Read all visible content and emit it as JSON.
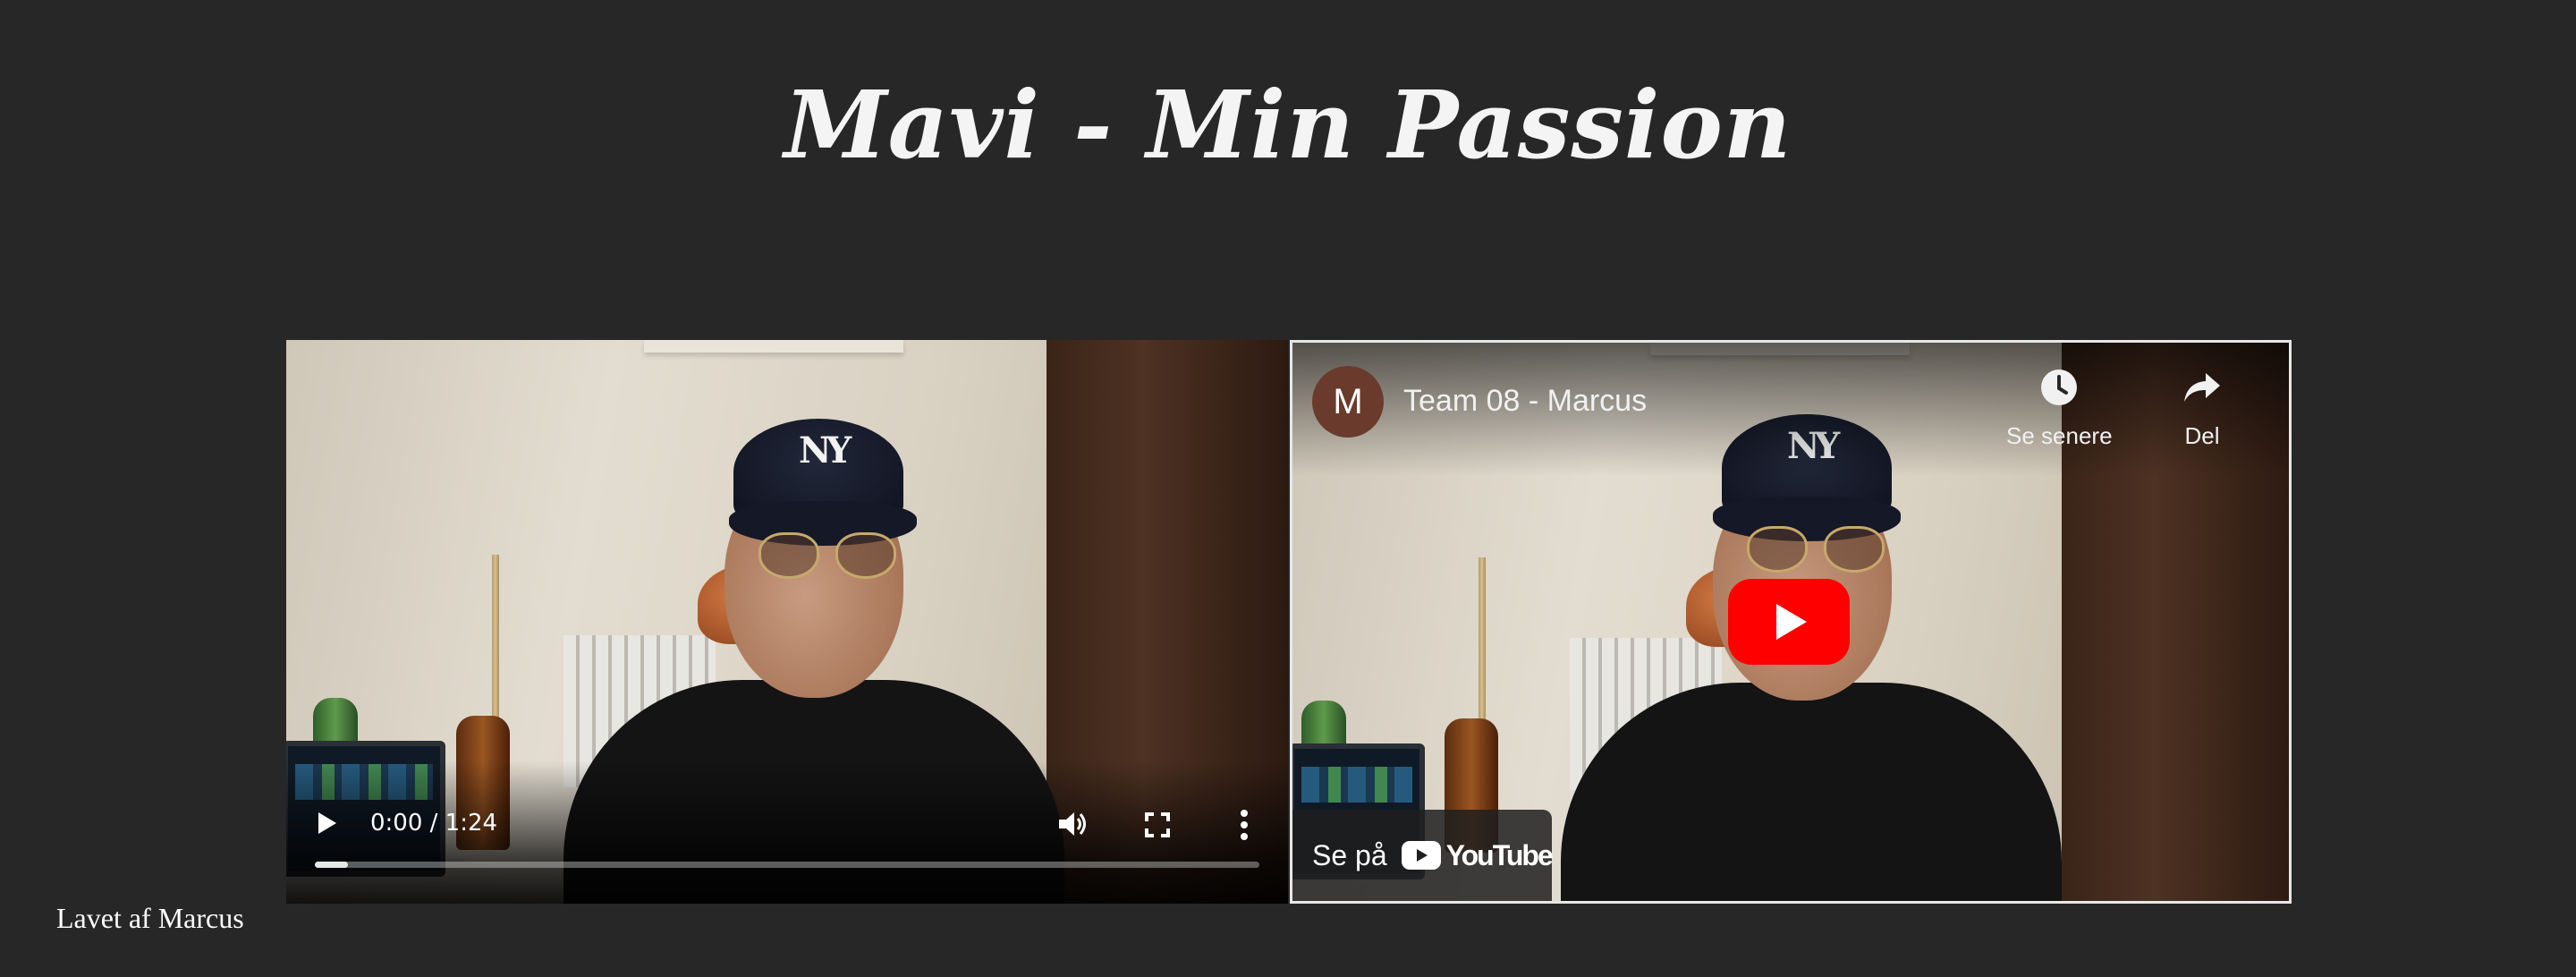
{
  "page": {
    "title": "Mavi - Min Passion",
    "footer": "Lavet af Marcus",
    "background": "#272727"
  },
  "native_video": {
    "time": "0:00 / 1:24",
    "progress": 0.035,
    "icons": {
      "play": "play-icon",
      "volume": "volume-icon",
      "fullscreen": "fullscreen-icon",
      "more": "more-vertical-icon"
    }
  },
  "youtube_embed": {
    "channel_initial": "M",
    "channel_title": "Team 08 - Marcus",
    "watch_later_label": "Se senere",
    "share_label": "Del",
    "watch_on_label": "Se på",
    "youtube_wordmark": "YouTube",
    "accent": "#ff0000",
    "avatar_color": "#6a3b2c",
    "icons": {
      "watch_later": "clock-icon",
      "share": "share-arrow-icon",
      "play": "youtube-play-icon",
      "logo": "youtube-logo-icon"
    }
  }
}
